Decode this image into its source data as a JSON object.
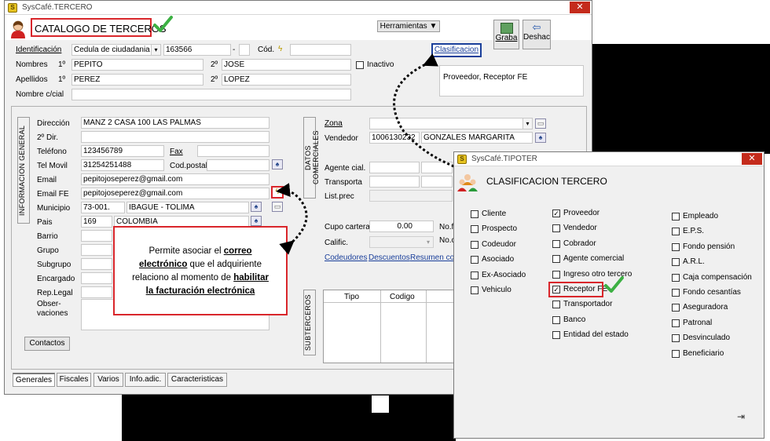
{
  "tercero_window": {
    "title": "SysCafé.TERCERO",
    "header_title": "CATALOGO DE TERCEROS",
    "herramientas_label": "Herramientas",
    "graba_label": "Graba",
    "deshacer_label": "Deshac",
    "clasificacion_label": "Clasificacion",
    "clasificacion_value": "Proveedor, Receptor FE",
    "identificacion_label": "Identificación",
    "id_type": "Cedula de ciudadania",
    "id_number": "163566",
    "id_dash": "-",
    "cod_label": "Cód.",
    "nombres_label": "Nombres",
    "apellidos_label": "Apellidos",
    "first_label": "1º",
    "second_label": "2º",
    "nombre1": "PEPITO",
    "nombre2": "JOSE",
    "apellido1": "PEREZ",
    "apellido2": "LOPEZ",
    "inactivo_label": "Inactivo",
    "nombre_cial_label": "Nombre c/cial",
    "info_general_tab": "INFORMACION GENERAL",
    "direccion_label": "Dirección",
    "direccion": "MANZ 2 CASA 100 LAS PALMAS",
    "dir2_label": "2º Dir.",
    "telefono_label": "Teléfono",
    "telefono": "123456789",
    "fax_label": "Fax",
    "movil_label": "Tel Movil",
    "movil": "31254251488",
    "codpostal_label": "Cod.postal",
    "email_label": "Email",
    "email": "pepitojoseperez@gmail.com",
    "emailfe_label": "Email FE",
    "emailfe": "pepitojoseperez@gmail.com",
    "municipio_label": "Municipio",
    "municipio_code": "73-001.",
    "municipio_name": "IBAGUE - TOLIMA",
    "pais_label": "Pais",
    "pais_code": "169",
    "pais_name": "COLOMBIA",
    "barrio_label": "Barrio",
    "grupo_label": "Grupo",
    "subgrupo_label": "Subgrupo",
    "encargado_label": "Encargado",
    "replegal_label": "Rep.Legal",
    "observaciones_label": "Obser-\nvaciones",
    "contactos_label": "Contactos",
    "datos_comerciales_tab": "DATOS COMERCIALES",
    "zona_label": "Zona",
    "vendedor_label": "Vendedor",
    "vendedor_code": "1006130232",
    "vendedor_name": "GONZALES MARGARITA",
    "agente_label": "Agente cial.",
    "transporta_label": "Transporta",
    "listprec_label": "List.prec",
    "cupo_label": "Cupo cartera",
    "cupo_value": "0.00",
    "nofac_label": "No.f",
    "calific_label": "Calific.",
    "noc_label": "No.c",
    "codeudores_link": "Codeudores",
    "descuentos_link": "Descuentos",
    "resumen_link": "Resumen cor",
    "subterceros_tab": "SUBTERCEROS",
    "grid_headers": [
      "Tipo",
      "Codigo"
    ],
    "tabs": [
      "Generales",
      "Fiscales",
      "Varios",
      "Info.adic.",
      "Caracteristicas"
    ]
  },
  "callout": {
    "line1_pre": "Permite asociar el ",
    "line1_bold": "correo",
    "line2_bold": "electrónico",
    "line2_post": " que el adquiriente",
    "line3_pre": "relaciono al momento de ",
    "line3_bold": "habilitar",
    "line4_bold": "la facturación electrónica"
  },
  "tipoter_window": {
    "title": "SysCafé.TIPOTER",
    "header_title": "CLASIFICACION TERCERO",
    "col1": [
      {
        "label": "Cliente",
        "checked": false
      },
      {
        "label": "Prospecto",
        "checked": false
      },
      {
        "label": "Codeudor",
        "checked": false
      },
      {
        "label": "Asociado",
        "checked": false
      },
      {
        "label": "Ex-Asociado",
        "checked": false
      },
      {
        "label": "Vehiculo",
        "checked": false
      }
    ],
    "col2": [
      {
        "label": "Proveedor",
        "checked": true
      },
      {
        "label": "Vendedor",
        "checked": false
      },
      {
        "label": "Cobrador",
        "checked": false
      },
      {
        "label": "Agente comercial",
        "checked": false
      },
      {
        "label": "Ingreso otro tercero",
        "checked": false
      },
      {
        "label": "Receptor FE",
        "checked": true
      },
      {
        "label": "Transportador",
        "checked": false
      },
      {
        "label": "Banco",
        "checked": false
      },
      {
        "label": "Entidad del estado",
        "checked": false
      }
    ],
    "col3": [
      {
        "label": "Empleado",
        "checked": false
      },
      {
        "label": "E.P.S.",
        "checked": false
      },
      {
        "label": "Fondo pensión",
        "checked": false
      },
      {
        "label": "A.R.L.",
        "checked": false
      },
      {
        "label": "Caja compensación",
        "checked": false
      },
      {
        "label": "Fondo cesantías",
        "checked": false
      },
      {
        "label": "Aseguradora",
        "checked": false
      },
      {
        "label": "Patronal",
        "checked": false
      },
      {
        "label": "Desvinculado",
        "checked": false
      },
      {
        "label": "Beneficiario",
        "checked": false
      }
    ]
  },
  "colors": {
    "highlight_red": "#d9262b",
    "check_green": "#3cb043",
    "link_blue": "#1a3f9a"
  }
}
